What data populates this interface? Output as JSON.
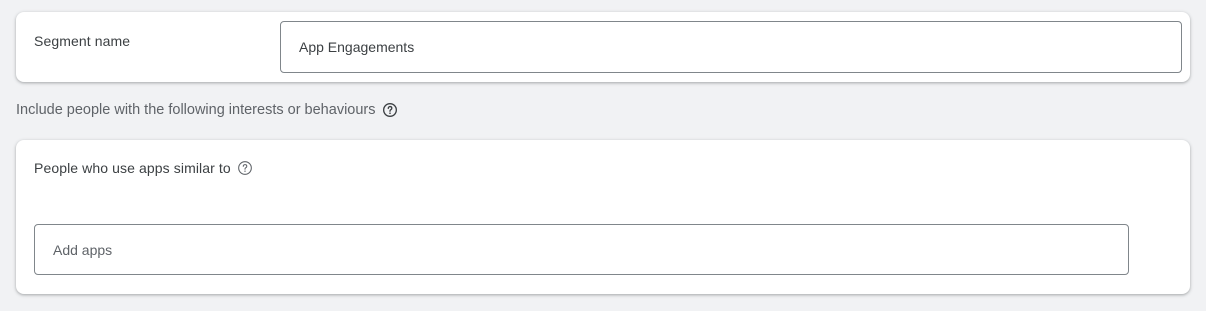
{
  "segment": {
    "label": "Segment name",
    "value": "App Engagements"
  },
  "interests": {
    "heading": "Include people with the following interests or behaviours",
    "help_icon": "help-circle-icon"
  },
  "apps": {
    "label": "People who use apps similar to",
    "help_icon": "help-circle-icon",
    "placeholder": "Add apps",
    "value": ""
  }
}
